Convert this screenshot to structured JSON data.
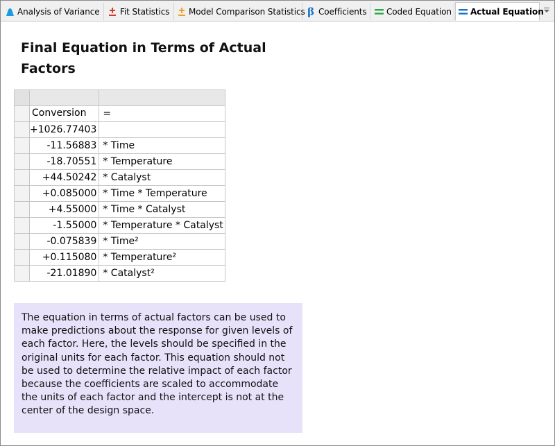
{
  "tabs": [
    {
      "label": "Analysis of Variance",
      "icon": "anova-bell-icon",
      "color": "#1a9be0",
      "active": false
    },
    {
      "label": "Fit Statistics",
      "icon": "plus-minus-icon",
      "color": "#d23a2a",
      "active": false
    },
    {
      "label": "Model Comparison Statistics",
      "icon": "plus-minus-icon",
      "color": "#f0a020",
      "active": false
    },
    {
      "label": "Coefficients",
      "icon": "beta-icon",
      "color": "#1a73c9",
      "active": false
    },
    {
      "label": "Coded Equation",
      "icon": "equals-icon",
      "color": "#2aa845",
      "active": false
    },
    {
      "label": "Actual Equation",
      "icon": "equals-icon",
      "color": "#1a73c9",
      "active": true
    }
  ],
  "page": {
    "title": "Final Equation in Terms of Actual Factors"
  },
  "equation": {
    "response": "Conversion",
    "equals": "=",
    "rows": [
      {
        "coef": "+1026.77403",
        "term": ""
      },
      {
        "coef": "-11.56883",
        "term": "* Time"
      },
      {
        "coef": "-18.70551",
        "term": "* Temperature"
      },
      {
        "coef": "+44.50242",
        "term": "* Catalyst"
      },
      {
        "coef": "+0.085000",
        "term": "* Time * Temperature"
      },
      {
        "coef": "+4.55000",
        "term": "* Time * Catalyst"
      },
      {
        "coef": "-1.55000",
        "term": "* Temperature * Catalyst"
      },
      {
        "coef": "-0.075839",
        "term": "* Time²"
      },
      {
        "coef": "+0.115080",
        "term": "* Temperature²"
      },
      {
        "coef": "-21.01890",
        "term": "* Catalyst²"
      }
    ]
  },
  "note": {
    "text": "The equation in terms of actual factors can be used to make predictions about the response for given levels of each factor. Here, the levels should be specified in the original units for each factor. This equation should not be used to determine the relative impact of each factor because the coefficients are scaled to accommodate the units of each factor and the intercept is not at the center of the design space."
  },
  "colors": {
    "note_background": "#e8e1fa",
    "tabstrip_background": "#f0f0f0"
  }
}
